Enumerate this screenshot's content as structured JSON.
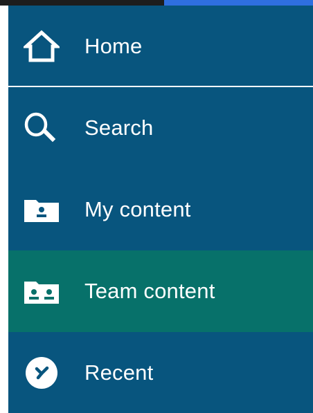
{
  "nav": {
    "items": [
      {
        "label": "Home",
        "icon": "home-icon",
        "active": false
      },
      {
        "label": "Search",
        "icon": "search-icon",
        "active": false
      },
      {
        "label": "My content",
        "icon": "folder-user-icon",
        "active": false
      },
      {
        "label": "Team content",
        "icon": "folder-team-icon",
        "active": true
      },
      {
        "label": "Recent",
        "icon": "clock-icon",
        "active": false
      }
    ]
  },
  "colors": {
    "nav_background": "#08557e",
    "active_background": "#07716a",
    "text": "#ffffff",
    "topbar_dark": "#1d1d1d",
    "topbar_blue": "#2f6fe0"
  }
}
